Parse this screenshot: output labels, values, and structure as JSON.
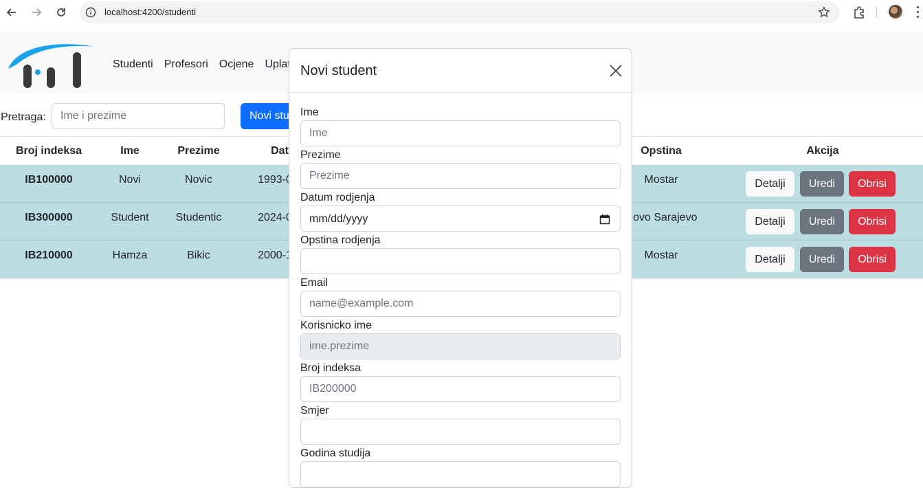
{
  "browser": {
    "url": "localhost:4200/studenti"
  },
  "nav": {
    "links": [
      "Studenti",
      "Profesori",
      "Ocjene",
      "Uplat"
    ]
  },
  "search": {
    "label": "Pretraga:",
    "placeholder": "Ime i prezime",
    "new_button": "Novi stu"
  },
  "table": {
    "headers": [
      "Broj indeksa",
      "Ime",
      "Prezime",
      "Dat",
      "Opstina",
      "Akcija"
    ],
    "rows": [
      {
        "index": "IB100000",
        "ime": "Novi",
        "prezime": "Novic",
        "datum": "1993-0",
        "opstina": "Mostar"
      },
      {
        "index": "IB300000",
        "ime": "Student",
        "prezime": "Studentic",
        "datum": "2024-0",
        "opstina": "Novo Sarajevo"
      },
      {
        "index": "IB210000",
        "ime": "Hamza",
        "prezime": "Bikic",
        "datum": "2000-1",
        "opstina": "Mostar"
      }
    ],
    "actions": {
      "detalji": "Detalji",
      "uredi": "Uredi",
      "obrisi": "Obrisi"
    }
  },
  "modal": {
    "title": "Novi student",
    "fields": {
      "ime": {
        "label": "Ime",
        "placeholder": "Ime"
      },
      "prezime": {
        "label": "Prezime",
        "placeholder": "Prezime"
      },
      "datum": {
        "label": "Datum rodjenja",
        "placeholder": "mm/dd/yyyy"
      },
      "opstina": {
        "label": "Opstina rodjenja",
        "placeholder": ""
      },
      "email": {
        "label": "Email",
        "placeholder": "name@example.com"
      },
      "korisnicko": {
        "label": "Korisnicko ime",
        "placeholder": "ime.prezime"
      },
      "indeks": {
        "label": "Broj indeksa",
        "placeholder": "IB200000"
      },
      "smjer": {
        "label": "Smjer",
        "placeholder": ""
      },
      "godina": {
        "label": "Godina studija",
        "placeholder": ""
      }
    }
  },
  "colors": {
    "primary": "#0d6efd",
    "danger": "#dc3545",
    "secondary": "#6c757d",
    "row_bg": "#bcdde2",
    "logo_blue": "#1aa3e8"
  }
}
